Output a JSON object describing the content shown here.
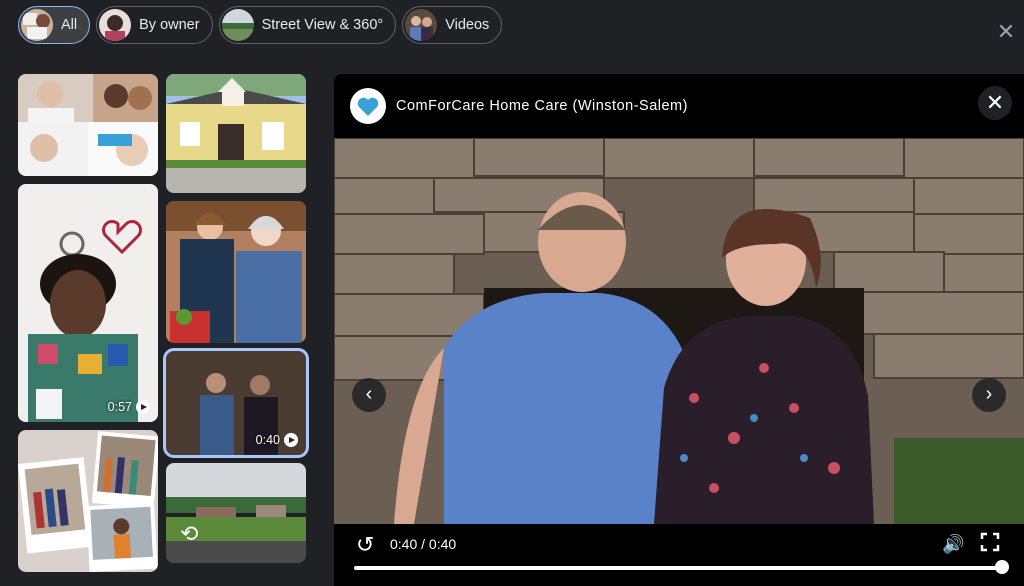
{
  "chips": [
    {
      "label": "All",
      "icon": "photo-collage-thumb",
      "active": true
    },
    {
      "label": "By owner",
      "icon": "owner-avatar-thumb",
      "active": false
    },
    {
      "label": "Street View & 360°",
      "icon": "street-view-thumb",
      "active": false
    },
    {
      "label": "Videos",
      "icon": "video-thumb",
      "active": false
    }
  ],
  "grid": {
    "video1_duration": "0:57",
    "video2_duration": "0:40"
  },
  "viewer": {
    "title": "ComForCare Home Care (Winston-Salem)",
    "logo_text": "ComForCare",
    "time": "0:40 / 0:40",
    "progress": 1.0
  },
  "colors": {
    "background": "#202124",
    "accent": "#8ab4f8",
    "selected": "#a8c7fa",
    "logo": "#3aa0d8"
  }
}
